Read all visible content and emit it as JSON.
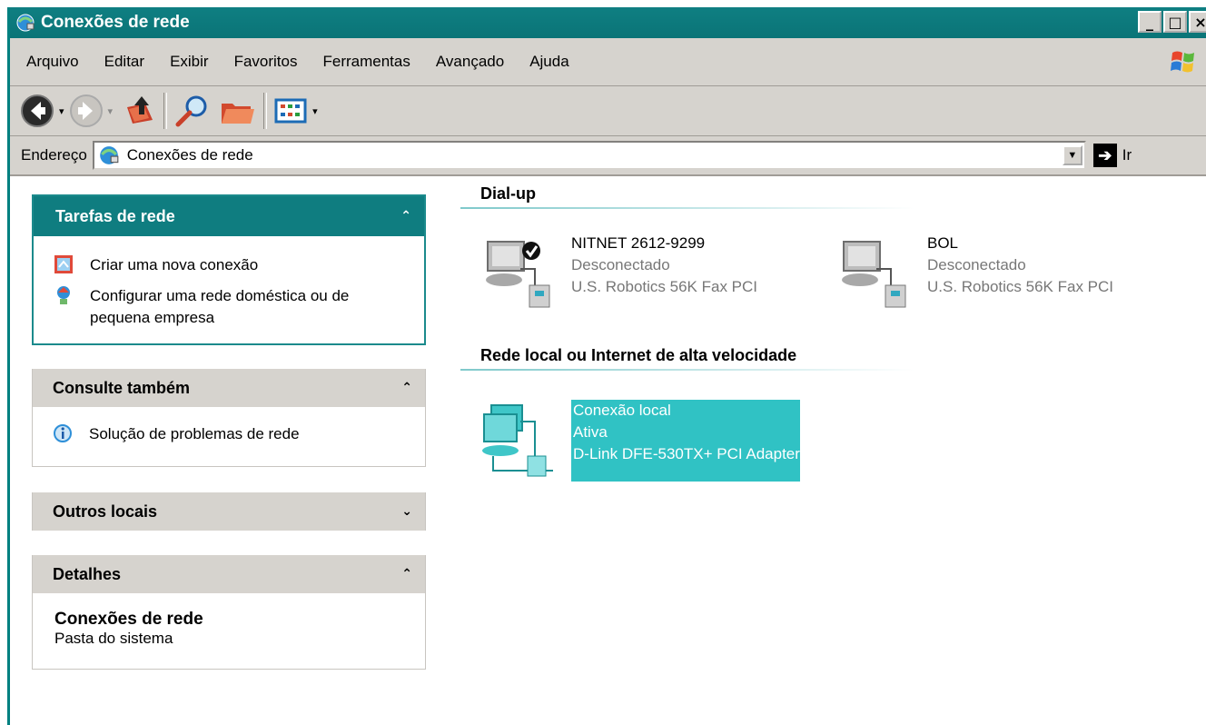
{
  "window": {
    "title": "Conexões de rede",
    "controls": [
      "_",
      "□",
      "×"
    ]
  },
  "menu": [
    "Arquivo",
    "Editar",
    "Exibir",
    "Favoritos",
    "Ferramentas",
    "Avançado",
    "Ajuda"
  ],
  "address": {
    "label": "Endereço",
    "value": "Conexões de rede",
    "go_label": "Ir"
  },
  "panels": {
    "tasks": {
      "title": "Tarefas de rede",
      "items": [
        "Criar uma nova conexão",
        "Configurar uma rede doméstica ou de pequena empresa"
      ]
    },
    "see_also": {
      "title": "Consulte também",
      "items": [
        "Solução de problemas de rede"
      ]
    },
    "other_places": {
      "title": "Outros locais"
    },
    "details": {
      "title": "Detalhes",
      "name": "Conexões de rede",
      "type": "Pasta do sistema"
    }
  },
  "groups": {
    "dialup": {
      "title": "Dial-up",
      "connections": [
        {
          "name": "NITNET 2612-9299",
          "status": "Desconectado",
          "device": "U.S. Robotics 56K Fax PCI",
          "default": true
        },
        {
          "name": "BOL",
          "status": "Desconectado",
          "device": "U.S. Robotics 56K Fax PCI",
          "default": false
        }
      ]
    },
    "lan": {
      "title": "Rede local ou Internet de alta velocidade",
      "connections": [
        {
          "name": "Conexão local",
          "status": "Ativa",
          "device": "D-Link DFE-530TX+ PCI Adapter",
          "selected": true
        }
      ]
    }
  },
  "colors": {
    "titlebar": "#0f7f82",
    "selection": "#30c2c4",
    "chrome": "#d6d3ce"
  }
}
